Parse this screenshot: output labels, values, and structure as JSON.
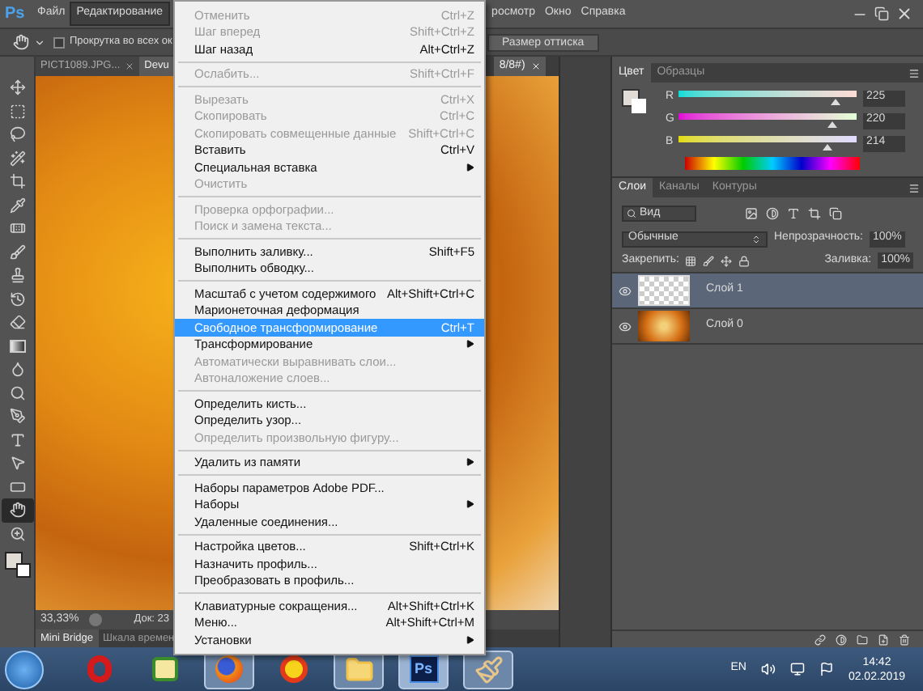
{
  "app_logo": "Ps",
  "menu_bar": {
    "items": [
      {
        "label": "Файл",
        "selected": false
      },
      {
        "label": "Редактирование",
        "selected": true
      },
      {
        "label": "росмотр",
        "selected": false
      },
      {
        "label": "Окно",
        "selected": false
      },
      {
        "label": "Справка",
        "selected": false
      }
    ]
  },
  "options_bar": {
    "scroll_all_windows": {
      "label": "Прокрутка во всех ок",
      "checked": false
    },
    "print_size_button": "Размер оттиска"
  },
  "document_tabs": [
    {
      "label": "PICT1089.JPG...",
      "selected": false
    },
    {
      "label": "Devu",
      "label_after_menu": "8/8#)",
      "selected": true
    }
  ],
  "status_bar": {
    "zoom": "33,33%",
    "doc_info": "Док: 23"
  },
  "bottom_tabs": [
    {
      "label": "Mini Bridge",
      "selected": true
    },
    {
      "label": "Шкала времен",
      "selected": false
    }
  ],
  "tools": [
    {
      "kind": "move",
      "selected": false
    },
    {
      "kind": "marquee",
      "selected": false
    },
    {
      "kind": "lasso",
      "selected": false
    },
    {
      "kind": "wand",
      "selected": false
    },
    {
      "kind": "crop",
      "selected": false
    },
    {
      "kind": "eyedropper",
      "selected": false
    },
    {
      "kind": "healing",
      "selected": false
    },
    {
      "kind": "brush",
      "selected": false
    },
    {
      "kind": "stamp",
      "selected": false
    },
    {
      "kind": "history",
      "selected": false
    },
    {
      "kind": "eraser",
      "selected": false
    },
    {
      "kind": "gradient",
      "selected": false
    },
    {
      "kind": "blur",
      "selected": false
    },
    {
      "kind": "dodge",
      "selected": false
    },
    {
      "kind": "pen",
      "selected": false
    },
    {
      "kind": "type",
      "selected": false
    },
    {
      "kind": "path",
      "selected": false
    },
    {
      "kind": "shape",
      "selected": false
    },
    {
      "kind": "hand",
      "selected": true
    },
    {
      "kind": "zoom",
      "selected": false
    }
  ],
  "edit_menu": {
    "items": [
      {
        "kind": "item",
        "label": "Отменить",
        "shortcut": "Ctrl+Z",
        "disabled": true,
        "selected": false,
        "submenu": false
      },
      {
        "kind": "item",
        "label": "Шаг вперед",
        "shortcut": "Shift+Ctrl+Z",
        "disabled": true,
        "selected": false,
        "submenu": false
      },
      {
        "kind": "item",
        "label": "Шаг назад",
        "shortcut": "Alt+Ctrl+Z",
        "disabled": false,
        "selected": false,
        "submenu": false
      },
      {
        "kind": "separator"
      },
      {
        "kind": "item",
        "label": "Ослабить...",
        "shortcut": "Shift+Ctrl+F",
        "disabled": true,
        "selected": false,
        "submenu": false
      },
      {
        "kind": "separator"
      },
      {
        "kind": "item",
        "label": "Вырезать",
        "shortcut": "Ctrl+X",
        "disabled": true,
        "selected": false,
        "submenu": false
      },
      {
        "kind": "item",
        "label": "Скопировать",
        "shortcut": "Ctrl+C",
        "disabled": true,
        "selected": false,
        "submenu": false
      },
      {
        "kind": "item",
        "label": "Скопировать совмещенные данные",
        "shortcut": "Shift+Ctrl+C",
        "disabled": true,
        "selected": false,
        "submenu": false
      },
      {
        "kind": "item",
        "label": "Вставить",
        "shortcut": "Ctrl+V",
        "disabled": false,
        "selected": false,
        "submenu": false
      },
      {
        "kind": "item",
        "label": "Специальная вставка",
        "disabled": false,
        "selected": false,
        "submenu": true
      },
      {
        "kind": "item",
        "label": "Очистить",
        "disabled": true,
        "selected": false,
        "submenu": false
      },
      {
        "kind": "separator"
      },
      {
        "kind": "item",
        "label": "Проверка орфографии...",
        "disabled": true,
        "selected": false,
        "submenu": false
      },
      {
        "kind": "item",
        "label": "Поиск и замена текста...",
        "disabled": true,
        "selected": false,
        "submenu": false
      },
      {
        "kind": "separator"
      },
      {
        "kind": "item",
        "label": "Выполнить заливку...",
        "shortcut": "Shift+F5",
        "disabled": false,
        "selected": false,
        "submenu": false
      },
      {
        "kind": "item",
        "label": "Выполнить обводку...",
        "disabled": false,
        "selected": false,
        "submenu": false
      },
      {
        "kind": "separator"
      },
      {
        "kind": "item",
        "label": "Масштаб с учетом содержимого",
        "shortcut": "Alt+Shift+Ctrl+C",
        "disabled": false,
        "selected": false,
        "submenu": false
      },
      {
        "kind": "item",
        "label": "Марионеточная деформация",
        "disabled": false,
        "selected": false,
        "submenu": false
      },
      {
        "kind": "item",
        "label": "Свободное трансформирование",
        "shortcut": "Ctrl+T",
        "disabled": false,
        "selected": true,
        "submenu": false
      },
      {
        "kind": "item",
        "label": "Трансформирование",
        "disabled": false,
        "selected": false,
        "submenu": true
      },
      {
        "kind": "item",
        "label": "Автоматически выравнивать слои...",
        "disabled": true,
        "selected": false,
        "submenu": false
      },
      {
        "kind": "item",
        "label": "Автоналожение слоев...",
        "disabled": true,
        "selected": false,
        "submenu": false
      },
      {
        "kind": "separator"
      },
      {
        "kind": "item",
        "label": "Определить кисть...",
        "disabled": false,
        "selected": false,
        "submenu": false
      },
      {
        "kind": "item",
        "label": "Определить узор...",
        "disabled": false,
        "selected": false,
        "submenu": false
      },
      {
        "kind": "item",
        "label": "Определить произвольную фигуру...",
        "disabled": true,
        "selected": false,
        "submenu": false
      },
      {
        "kind": "separator"
      },
      {
        "kind": "item",
        "label": "Удалить из памяти",
        "disabled": false,
        "selected": false,
        "submenu": true
      },
      {
        "kind": "separator"
      },
      {
        "kind": "item",
        "label": "Наборы параметров Adobe PDF...",
        "disabled": false,
        "selected": false,
        "submenu": false
      },
      {
        "kind": "item",
        "label": "Наборы",
        "disabled": false,
        "selected": false,
        "submenu": true
      },
      {
        "kind": "item",
        "label": "Удаленные соединения...",
        "disabled": false,
        "selected": false,
        "submenu": false
      },
      {
        "kind": "separator"
      },
      {
        "kind": "item",
        "label": "Настройка цветов...",
        "shortcut": "Shift+Ctrl+K",
        "disabled": false,
        "selected": false,
        "submenu": false
      },
      {
        "kind": "item",
        "label": "Назначить профиль...",
        "disabled": false,
        "selected": false,
        "submenu": false
      },
      {
        "kind": "item",
        "label": "Преобразовать в профиль...",
        "disabled": false,
        "selected": false,
        "submenu": false
      },
      {
        "kind": "separator"
      },
      {
        "kind": "item",
        "label": "Клавиатурные сокращения...",
        "shortcut": "Alt+Shift+Ctrl+K",
        "disabled": false,
        "selected": false,
        "submenu": false
      },
      {
        "kind": "item",
        "label": "Меню...",
        "shortcut": "Alt+Shift+Ctrl+M",
        "disabled": false,
        "selected": false,
        "submenu": false
      },
      {
        "kind": "item",
        "label": "Установки",
        "disabled": false,
        "selected": false,
        "submenu": true
      }
    ]
  },
  "color_panel": {
    "tabs": [
      {
        "label": "Цвет",
        "selected": true
      },
      {
        "label": "Образцы",
        "selected": false
      }
    ],
    "channels": [
      {
        "name": "R",
        "value": "225",
        "level": 0.88
      },
      {
        "name": "G",
        "value": "220",
        "level": 0.86
      },
      {
        "name": "B",
        "value": "214",
        "level": 0.84
      }
    ]
  },
  "layers_panel": {
    "tabs": [
      {
        "label": "Слои",
        "selected": true
      },
      {
        "label": "Каналы",
        "selected": false
      },
      {
        "label": "Контуры",
        "selected": false
      }
    ],
    "filter": "Вид",
    "blend_mode": "Обычные",
    "opacity_label": "Непрозрачность:",
    "opacity": "100%",
    "lock_label": "Закрепить:",
    "fill_label": "Заливка:",
    "fill": "100%",
    "layers": [
      {
        "name": "Слой 1",
        "selected": true,
        "visible": true,
        "kind": "transparent"
      },
      {
        "name": "Слой 0",
        "selected": false,
        "visible": true,
        "kind": "photo"
      }
    ]
  },
  "taskbar": {
    "apps": [
      {
        "kind": "opera",
        "running": false,
        "selected": false
      },
      {
        "kind": "tree",
        "running": false,
        "selected": false
      },
      {
        "kind": "firefox",
        "running": true,
        "selected": false
      },
      {
        "kind": "onec",
        "running": false,
        "selected": false
      },
      {
        "kind": "explorer",
        "running": true,
        "selected": false
      },
      {
        "kind": "photoshop",
        "running": true,
        "selected": true,
        "label": "Ps"
      },
      {
        "kind": "paint",
        "running": true,
        "selected": false
      }
    ],
    "language": "EN",
    "time": "14:42",
    "date": "02.02.2019"
  }
}
